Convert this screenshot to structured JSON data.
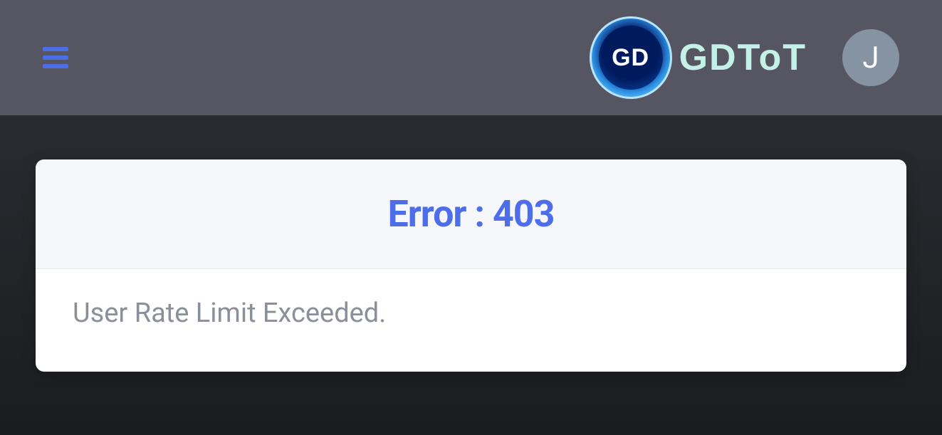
{
  "header": {
    "logo_short": "GD",
    "brand_name": "GDToT",
    "avatar_letter": "J"
  },
  "error": {
    "title": "Error : 403",
    "message": "User Rate Limit Exceeded."
  }
}
